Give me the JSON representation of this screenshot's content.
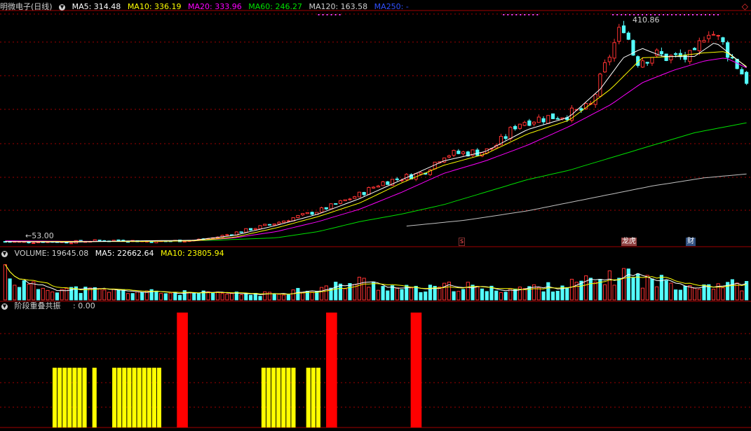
{
  "main_header": {
    "stock": "明微电子(日线)",
    "ma5": "MA5: 314.48",
    "ma10": "MA10: 336.19",
    "ma20": "MA20: 333.96",
    "ma60": "MA60: 246.27",
    "ma120": "MA120: 163.58",
    "ma250": "MA250: -"
  },
  "volume_header": {
    "label": "VOLUME: 19645.08",
    "ma5": "MA5: 22662.64",
    "ma10": "MA10: 23805.94"
  },
  "indicator_header": {
    "name": "阶段重叠共振",
    "value": ": 0.00"
  },
  "annotations": {
    "high": "410.86",
    "low": "53.00",
    "marker_s": "s",
    "marker_rank": "龙虎",
    "marker_fin": "财"
  },
  "colors": {
    "up": "#ff3232",
    "down": "#54ffff",
    "ma5": "#ffffff",
    "ma10": "#ffff00",
    "ma20": "#ff00ff",
    "ma60": "#00e000",
    "ma120": "#c0c0c0",
    "ma250": "#3050ff",
    "grid": "#a00000",
    "yellow_bar": "#ffff00",
    "red_bar": "#ff0000"
  },
  "chart_data": {
    "type": "candlestick",
    "sessions": 158,
    "anchors": {
      "close": [
        [
          0,
          56
        ],
        [
          10,
          55
        ],
        [
          20,
          56
        ],
        [
          30,
          55
        ],
        [
          40,
          57
        ],
        [
          55,
          58
        ],
        [
          70,
          56
        ],
        [
          90,
          58
        ],
        [
          100,
          62
        ],
        [
          110,
          70
        ],
        [
          120,
          78
        ],
        [
          130,
          86
        ],
        [
          140,
          96
        ],
        [
          150,
          105
        ],
        [
          160,
          118
        ],
        [
          170,
          132
        ],
        [
          180,
          150
        ],
        [
          190,
          158
        ],
        [
          200,
          166
        ],
        [
          210,
          195
        ],
        [
          220,
          198
        ],
        [
          230,
          200
        ],
        [
          235,
          210
        ],
        [
          240,
          225
        ],
        [
          245,
          245
        ],
        [
          250,
          250
        ],
        [
          260,
          255
        ],
        [
          270,
          260
        ],
        [
          280,
          270
        ],
        [
          290,
          360
        ],
        [
          296,
          405
        ],
        [
          302,
          345
        ],
        [
          310,
          355
        ],
        [
          320,
          350
        ],
        [
          330,
          350
        ],
        [
          336,
          400
        ],
        [
          344,
          370
        ],
        [
          355,
          315
        ]
      ],
      "ma5": [
        [
          0,
          56
        ],
        [
          30,
          55
        ],
        [
          60,
          57
        ],
        [
          90,
          58
        ],
        [
          110,
          66
        ],
        [
          130,
          82
        ],
        [
          150,
          100
        ],
        [
          170,
          125
        ],
        [
          190,
          155
        ],
        [
          210,
          185
        ],
        [
          230,
          200
        ],
        [
          250,
          235
        ],
        [
          270,
          255
        ],
        [
          285,
          300
        ],
        [
          296,
          350
        ],
        [
          305,
          365
        ],
        [
          315,
          352
        ],
        [
          330,
          352
        ],
        [
          340,
          375
        ],
        [
          355,
          335
        ]
      ],
      "ma10": [
        [
          0,
          56
        ],
        [
          60,
          56
        ],
        [
          90,
          57
        ],
        [
          110,
          63
        ],
        [
          130,
          78
        ],
        [
          150,
          96
        ],
        [
          170,
          118
        ],
        [
          190,
          150
        ],
        [
          210,
          178
        ],
        [
          230,
          196
        ],
        [
          250,
          228
        ],
        [
          270,
          250
        ],
        [
          290,
          300
        ],
        [
          305,
          350
        ],
        [
          320,
          352
        ],
        [
          335,
          358
        ],
        [
          345,
          360
        ],
        [
          355,
          336
        ]
      ],
      "ma20": [
        [
          0,
          57
        ],
        [
          60,
          56
        ],
        [
          90,
          57
        ],
        [
          110,
          62
        ],
        [
          130,
          72
        ],
        [
          150,
          88
        ],
        [
          170,
          108
        ],
        [
          190,
          135
        ],
        [
          210,
          165
        ],
        [
          230,
          185
        ],
        [
          250,
          210
        ],
        [
          270,
          240
        ],
        [
          290,
          275
        ],
        [
          305,
          310
        ],
        [
          320,
          330
        ],
        [
          335,
          345
        ],
        [
          345,
          350
        ],
        [
          355,
          334
        ]
      ],
      "ma60": [
        [
          60,
          56
        ],
        [
          100,
          58
        ],
        [
          130,
          62
        ],
        [
          150,
          72
        ],
        [
          170,
          88
        ],
        [
          190,
          100
        ],
        [
          210,
          115
        ],
        [
          230,
          135
        ],
        [
          250,
          155
        ],
        [
          270,
          170
        ],
        [
          290,
          190
        ],
        [
          310,
          210
        ],
        [
          330,
          230
        ],
        [
          355,
          246
        ]
      ],
      "ma120": [
        [
          190,
          80
        ],
        [
          220,
          90
        ],
        [
          250,
          105
        ],
        [
          280,
          125
        ],
        [
          310,
          145
        ],
        [
          335,
          158
        ],
        [
          355,
          164
        ]
      ]
    },
    "high_low": {
      "high": 410.86,
      "low": 53.0
    },
    "ylim": [
      50,
      420
    ],
    "volume": {
      "anchors": [
        [
          0,
          45000
        ],
        [
          5,
          25000
        ],
        [
          15,
          18000
        ],
        [
          25,
          16000
        ],
        [
          40,
          14000
        ],
        [
          60,
          12000
        ],
        [
          80,
          10000
        ],
        [
          100,
          9000
        ],
        [
          120,
          8000
        ],
        [
          130,
          9000
        ],
        [
          140,
          14000
        ],
        [
          150,
          16000
        ],
        [
          160,
          20000
        ],
        [
          170,
          26000
        ],
        [
          180,
          20000
        ],
        [
          190,
          16000
        ],
        [
          200,
          14000
        ],
        [
          210,
          18000
        ],
        [
          220,
          20000
        ],
        [
          230,
          14000
        ],
        [
          240,
          16000
        ],
        [
          250,
          17000
        ],
        [
          260,
          18000
        ],
        [
          270,
          22000
        ],
        [
          290,
          30000
        ],
        [
          296,
          40000
        ],
        [
          305,
          28000
        ],
        [
          315,
          26000
        ],
        [
          325,
          22000
        ],
        [
          335,
          22000
        ],
        [
          345,
          23000
        ],
        [
          355,
          19645
        ]
      ],
      "ylim": [
        0,
        60000
      ]
    },
    "indicator": {
      "yellow_ranges": [
        [
          10,
          16
        ],
        [
          18,
          18
        ],
        [
          22,
          31
        ],
        [
          52,
          58
        ],
        [
          61,
          63
        ]
      ],
      "yellow_level": 0.52,
      "red_bars": [
        35,
        65,
        82
      ],
      "red_level": 1.0,
      "ylim": [
        0,
        1
      ]
    }
  }
}
